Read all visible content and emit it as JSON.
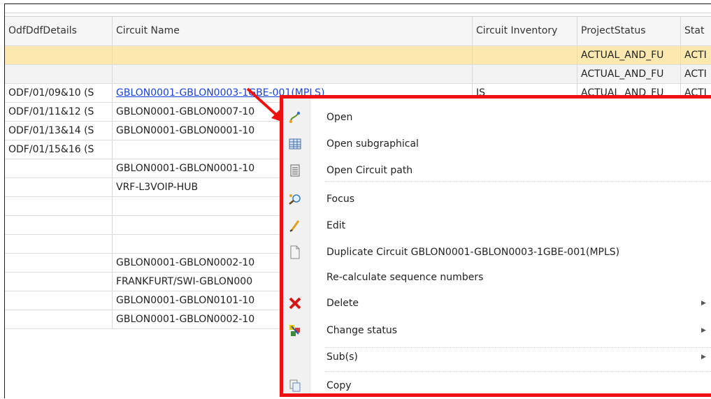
{
  "grid": {
    "columns": [
      "OdfDdfDetails",
      "Circuit Name",
      "Circuit Inventory",
      "ProjectStatus",
      "Stat"
    ],
    "rows": [
      {
        "odf": "",
        "circuit": "",
        "inv": "",
        "project": "ACTUAL_AND_FU",
        "status": "ACTI",
        "selected": true
      },
      {
        "odf": "",
        "circuit": "",
        "inv": "",
        "project": "ACTUAL_AND_FU",
        "status": "ACTI"
      },
      {
        "odf": "ODF/01/09&10 (S",
        "circuit": "GBLON0001-GBLON0003-1GBE-001(MPLS)",
        "inv": "IS",
        "project": "ACTUAL_AND_FU",
        "status": "ACTI"
      },
      {
        "odf": "ODF/01/11&12 (S",
        "circuit": "GBLON0001-GBLON0007-10",
        "inv": "",
        "project": "",
        "status": ""
      },
      {
        "odf": "ODF/01/13&14 (S",
        "circuit": "GBLON0001-GBLON0001-10",
        "inv": "",
        "project": "",
        "status": ""
      },
      {
        "odf": "ODF/01/15&16 (S",
        "circuit": "",
        "inv": "",
        "project": "",
        "status": ""
      },
      {
        "odf": "",
        "circuit": "GBLON0001-GBLON0001-10",
        "inv": "",
        "project": "",
        "status": ""
      },
      {
        "odf": "",
        "circuit": "VRF-L3VOIP-HUB",
        "inv": "",
        "project": "",
        "status": ""
      },
      {
        "odf": "",
        "circuit": "",
        "inv": "",
        "project": "",
        "status": ""
      },
      {
        "odf": "",
        "circuit": "",
        "inv": "",
        "project": "",
        "status": ""
      },
      {
        "odf": "",
        "circuit": "",
        "inv": "",
        "project": "",
        "status": ""
      },
      {
        "odf": "",
        "circuit": "GBLON0001-GBLON0002-10",
        "inv": "",
        "project": "",
        "status": ""
      },
      {
        "odf": "",
        "circuit": "FRANKFURT/SWI-GBLON000",
        "inv": "",
        "project": "",
        "status": ""
      },
      {
        "odf": "",
        "circuit": "GBLON0001-GBLON0101-10",
        "inv": "",
        "project": "",
        "status": ""
      },
      {
        "odf": "",
        "circuit": "GBLON0001-GBLON0002-10",
        "inv": "",
        "project": "",
        "status": ""
      }
    ]
  },
  "context_menu": {
    "items": [
      {
        "label": "Open",
        "icon": "open-icon",
        "submenu": false
      },
      {
        "label": "Open subgraphical",
        "icon": "table-icon",
        "submenu": false
      },
      {
        "label": "Open Circuit path",
        "icon": "circuit-path-icon",
        "submenu": false
      },
      {
        "label": "Focus",
        "icon": "focus-icon",
        "submenu": false
      },
      {
        "label": "Edit",
        "icon": "pencil-icon",
        "submenu": false
      },
      {
        "label": "Duplicate Circuit GBLON0001-GBLON0003-1GBE-001(MPLS)",
        "icon": "document-icon",
        "submenu": false
      },
      {
        "label": "Re-calculate sequence numbers",
        "icon": "",
        "submenu": false
      },
      {
        "label": "Delete",
        "icon": "delete-icon",
        "submenu": true
      },
      {
        "label": "Change status",
        "icon": "change-status-icon",
        "submenu": true
      },
      {
        "label": "Sub(s)",
        "icon": "",
        "submenu": true
      },
      {
        "label": "Copy",
        "icon": "copy-icon",
        "submenu": false
      }
    ],
    "submenu_glyph": "▶"
  },
  "colors": {
    "highlight_border": "#ee1111",
    "selected_row": "#fde9b0",
    "link": "#1a3fd6"
  }
}
